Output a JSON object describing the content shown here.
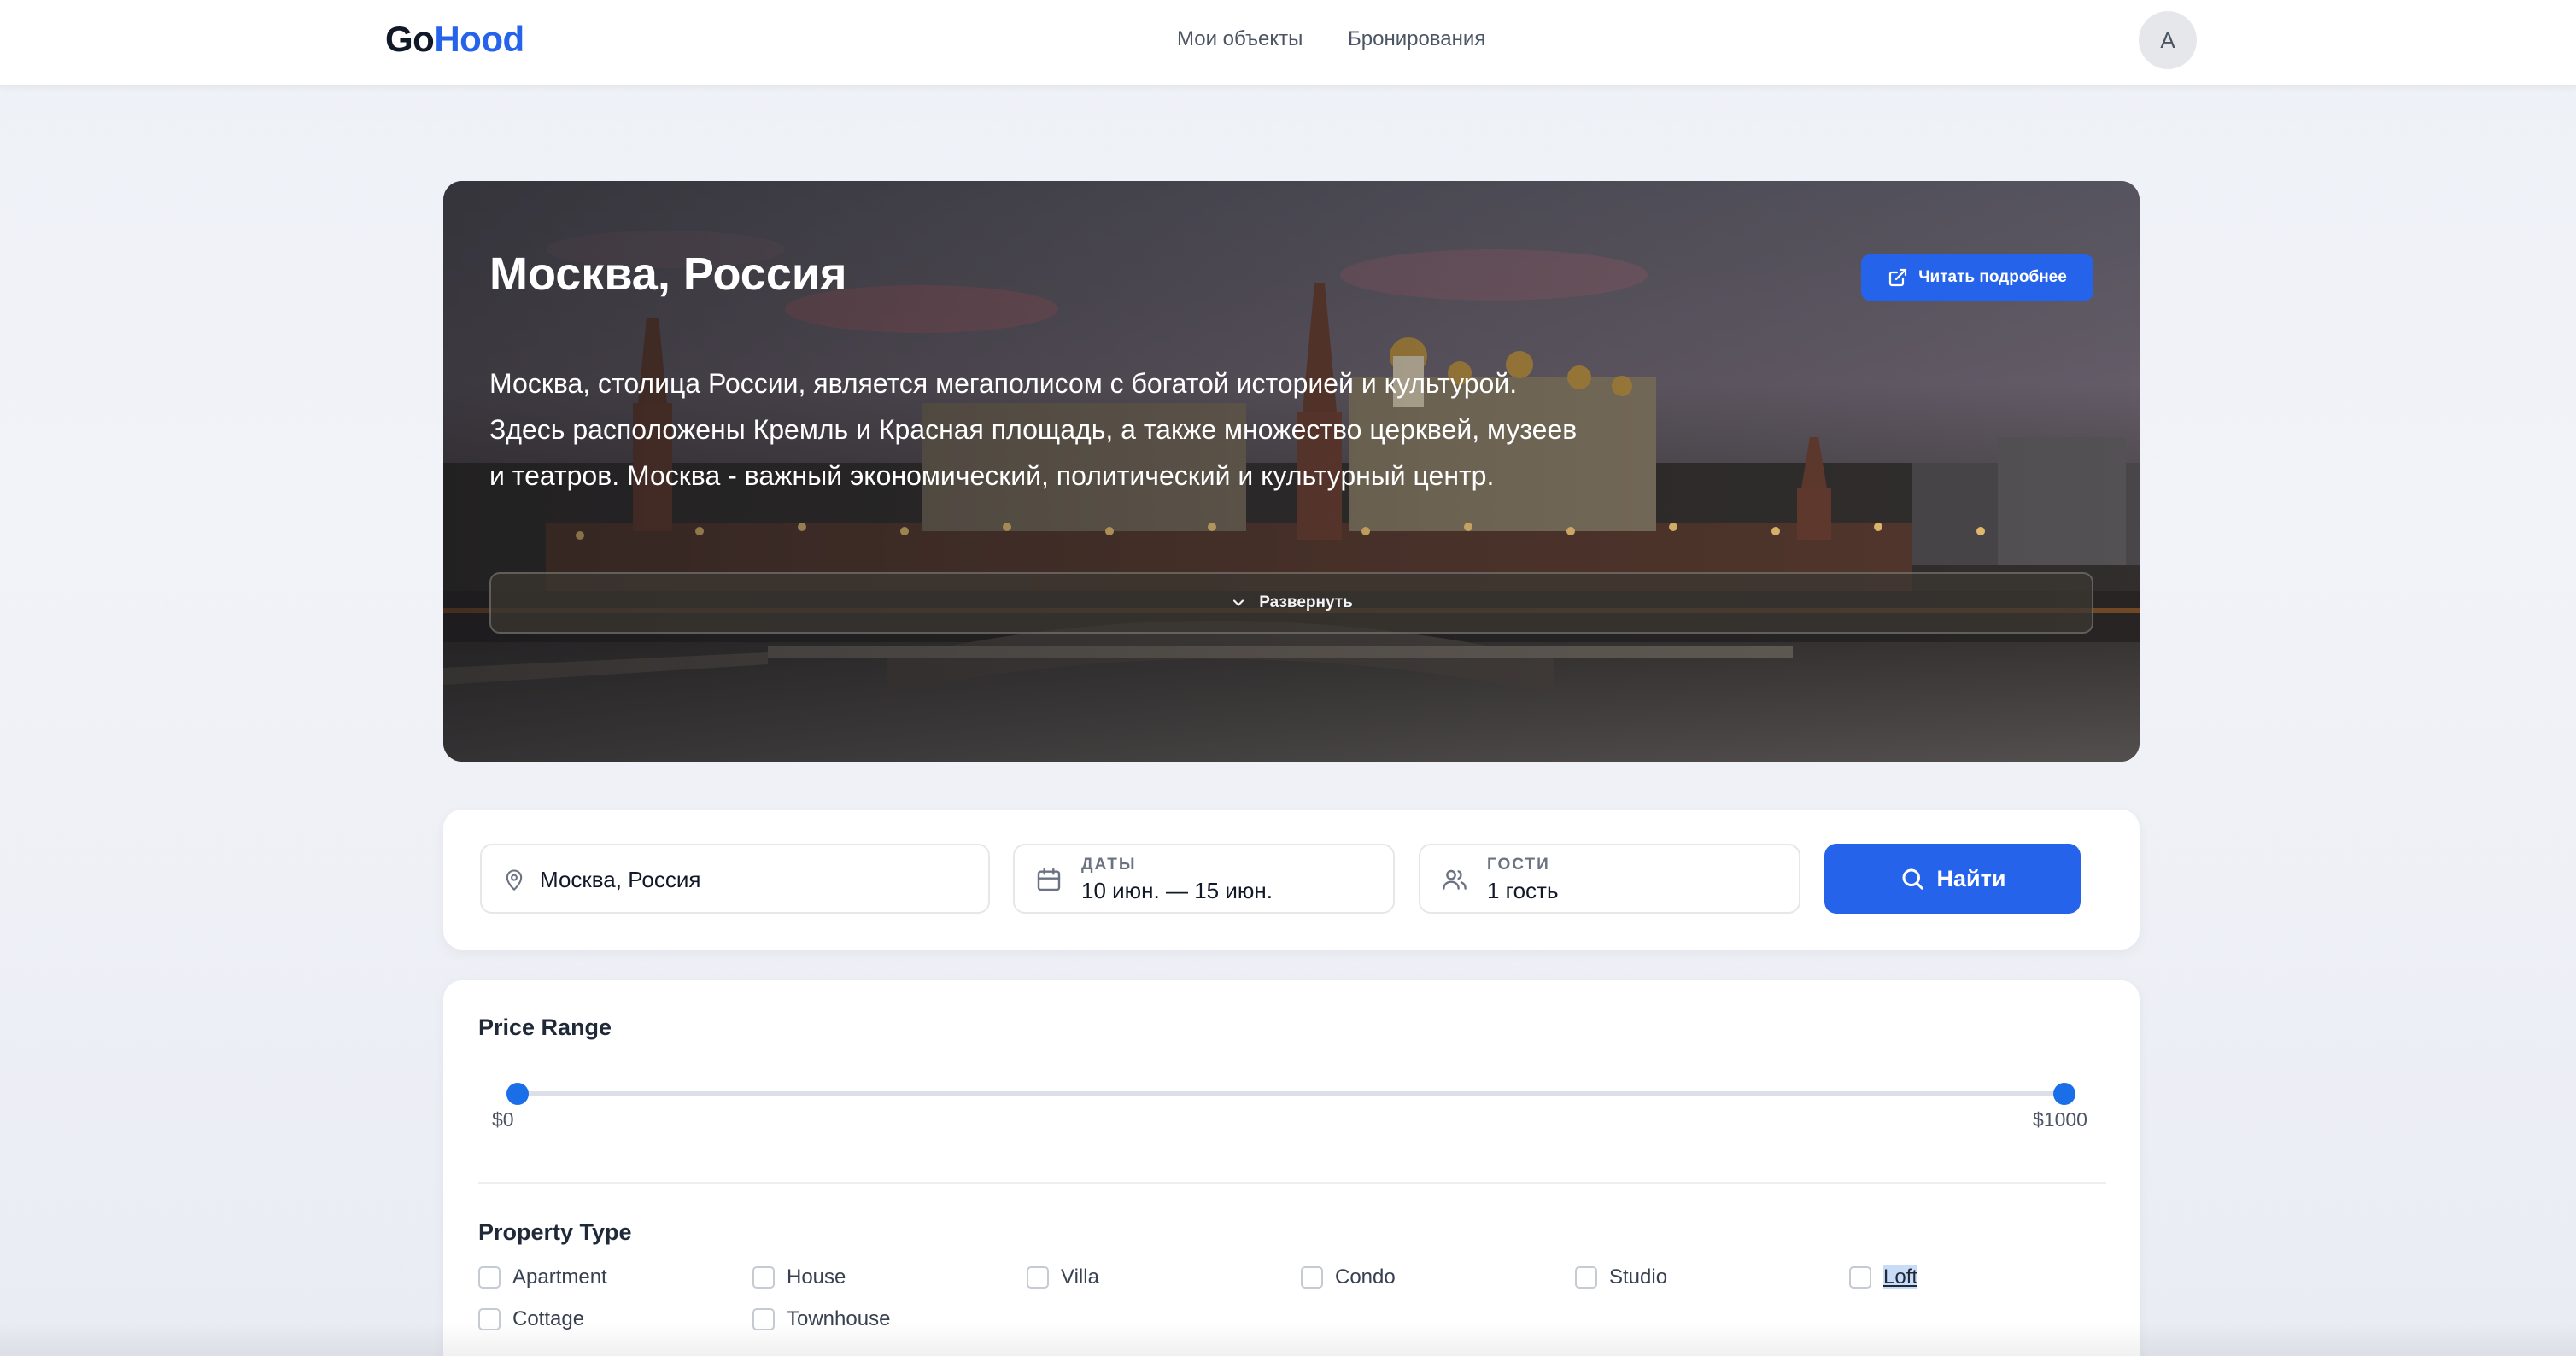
{
  "header": {
    "logo_part1": "Go",
    "logo_part2": "Hood",
    "nav": [
      "Мои объекты",
      "Бронирования"
    ],
    "avatar_initial": "A"
  },
  "hero": {
    "title": "Москва, Россия",
    "read_more": "Читать подробнее",
    "description_lines": [
      "Москва, столица России, является мегаполисом с богатой историей и культурой.",
      "Здесь расположены Кремль и Красная площадь, а также множество церквей, музеев",
      "и театров. Москва - важный экономический, политический и культурный центр."
    ],
    "expand_label": "Развернуть"
  },
  "search": {
    "location_value": "Москва, Россия",
    "dates_label": "ДАТЫ",
    "dates_value": "10 июн. — 15 июн.",
    "guests_label": "ГОСТИ",
    "guests_value": "1 гость",
    "button": "Найти"
  },
  "filters": {
    "price_title": "Price Range",
    "price_min_label": "$0",
    "price_max_label": "$1000",
    "price_min": 0,
    "price_max": 1000,
    "property_title": "Property Type",
    "property_types": [
      {
        "label": "Apartment",
        "checked": false
      },
      {
        "label": "House",
        "checked": false
      },
      {
        "label": "Villa",
        "checked": false
      },
      {
        "label": "Condo",
        "checked": false
      },
      {
        "label": "Studio",
        "checked": false
      },
      {
        "label": "Loft",
        "checked": false,
        "text_selected": true
      },
      {
        "label": "Cottage",
        "checked": false
      },
      {
        "label": "Townhouse",
        "checked": false
      }
    ]
  },
  "colors": {
    "accent": "#2563eb",
    "slider_thumb": "#1a6fe8"
  },
  "icons": [
    "map-pin-icon",
    "calendar-icon",
    "users-icon",
    "search-icon",
    "external-link-icon",
    "chevron-down-icon"
  ]
}
